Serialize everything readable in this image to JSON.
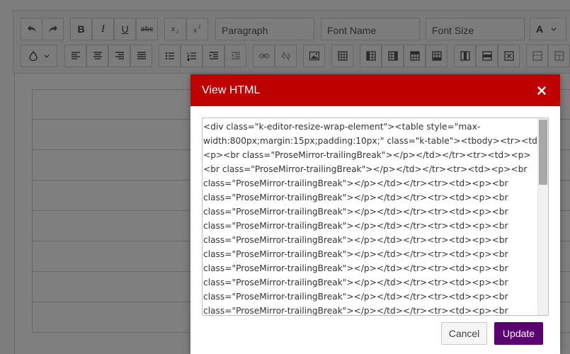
{
  "toolbar": {
    "paragraph_label": "Paragraph",
    "font_name_label": "Font Name",
    "font_size_label": "Font Size",
    "bold_label": "B",
    "italic_label": "I",
    "underline_label": "U",
    "strike_label": "abc",
    "text_color_label": "A"
  },
  "dialog": {
    "title": "View HTML",
    "html_lines": [
      "<div class=\"k-editor-resize-wrap-element\"><table style=\"max-",
      "width:800px;margin:15px;padding:10px;\" class=\"k-table\"><tbody><tr><td>",
      "<p><br class=\"ProseMirror-trailingBreak\"></p></td></tr><tr><td><p>",
      "<br class=\"ProseMirror-trailingBreak\"></p></td></tr><tr><td><p><br",
      "class=\"ProseMirror-trailingBreak\"></p></td></tr><tr><td><p><br",
      "class=\"ProseMirror-trailingBreak\"></p></td></tr><tr><td><p><br",
      "class=\"ProseMirror-trailingBreak\"></p></td></tr><tr><td><p><br",
      "class=\"ProseMirror-trailingBreak\"></p></td></tr><tr><td><p><br",
      "class=\"ProseMirror-trailingBreak\"></p></td></tr><tr><td><p><br",
      "class=\"ProseMirror-trailingBreak\"></p></td></tr><tr><td><p><br",
      "class=\"ProseMirror-trailingBreak\"></p></td></tr><tr><td><p><br",
      "class=\"ProseMirror-trailingBreak\"></p></td></tr><tr><td><p><br",
      "class=\"ProseMirror-trailingBreak\"></p></td></tr><tr><td><p><br",
      "class=\"ProseMirror-trailingBreak\"></p></td></tr><tr><td><p><br"
    ],
    "cancel_label": "Cancel",
    "update_label": "Update"
  },
  "colors": {
    "dialog_header": "#be0000",
    "primary_button": "#5b0071"
  }
}
